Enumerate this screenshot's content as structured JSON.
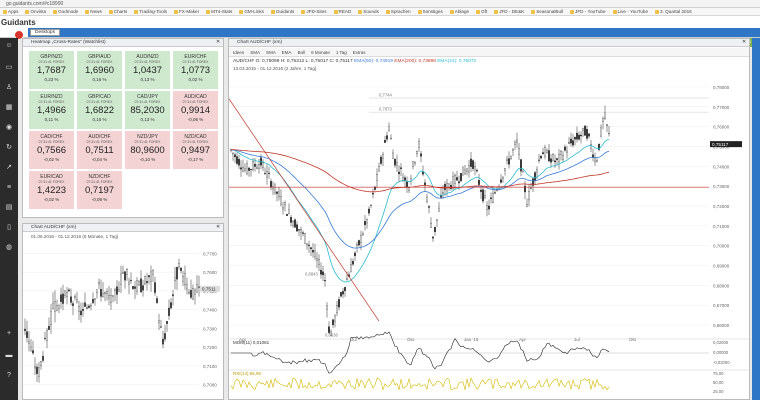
{
  "browser": {
    "url": "go.guidants.com/#c18990",
    "bookmarks": [
      "Apps",
      "Onvista",
      "Godmode",
      "News",
      "Charts",
      "Trading-Tools",
      "FX-Maker",
      "MT4-Stats",
      "GM-Links",
      "Guidants",
      "JFD-Sites",
      "READ",
      "Sounds",
      "Sprachen",
      "Sonstiges",
      "Ablage",
      "Gft",
      "JFD - DE&K",
      "SeasonalBull",
      "JFD - YouTube",
      "Live - YouTube",
      "3. Quartal 2016"
    ]
  },
  "app": {
    "logo": "Guidants",
    "desktops_label": "Desktops",
    "search_label": "Suche",
    "market_label": "Markt",
    "broker_label": "Broker Lo"
  },
  "heatmap": {
    "title": "Heatmap „Cross-Rates\" (Watchlist)",
    "tiles": [
      {
        "pair": "GBP/NZD",
        "sub": "07:31:41 FOREX",
        "value": "1,7687",
        "pct": "0,23 %",
        "tone": "green"
      },
      {
        "pair": "GBP/AUD",
        "sub": "07:31:41 FOREX",
        "value": "1,6960",
        "pct": "0,16 %",
        "tone": "green"
      },
      {
        "pair": "AUD/NZD",
        "sub": "07:31:41 FOREX",
        "value": "1,0437",
        "pct": "0,13 %",
        "tone": "green"
      },
      {
        "pair": "EUR/CHF",
        "sub": "07:31:41 FOREX",
        "value": "1,0773",
        "pct": "0,02 %",
        "tone": "green"
      },
      {
        "pair": "EUR/NZD",
        "sub": "07:31:41 FOREX",
        "value": "1,4966",
        "pct": "0,11 %",
        "tone": "green"
      },
      {
        "pair": "GBP/CAD",
        "sub": "07:31:41 FOREX",
        "value": "1,6822",
        "pct": "0,15 %",
        "tone": "green"
      },
      {
        "pair": "CAD/JPY",
        "sub": "07:31:41 FOREX",
        "value": "85,2030",
        "pct": "0,13 %",
        "tone": "green"
      },
      {
        "pair": "AUD/CAD",
        "sub": "07:31:41 FOREX",
        "value": "0,9914",
        "pct": "-0,06 %",
        "tone": "red"
      },
      {
        "pair": "CAD/CHF",
        "sub": "07:31:41 FOREX",
        "value": "0,7566",
        "pct": "-0,02 %",
        "tone": "red"
      },
      {
        "pair": "AUD/CHF",
        "sub": "07:31:41 FOREX",
        "value": "0,7511",
        "pct": "-0,04 %",
        "tone": "red"
      },
      {
        "pair": "NZD/JPY",
        "sub": "07:31:41 FOREX",
        "value": "80,9600",
        "pct": "-0,10 %",
        "tone": "red"
      },
      {
        "pair": "NZD/CAD",
        "sub": "07:31:41 FOREX",
        "value": "0,9497",
        "pct": "-0,17 %",
        "tone": "red"
      },
      {
        "pair": "EUR/CAD",
        "sub": "07:31:41 FOREX",
        "value": "1,4223",
        "pct": "-0,02 %",
        "tone": "red"
      },
      {
        "pair": "NZD/CHF",
        "sub": "07:31:41 FOREX",
        "value": "0,7197",
        "pct": "-0,09 %",
        "tone": "red"
      }
    ]
  },
  "small_chart": {
    "title": "Chart AUD/CHF (xm)",
    "range": "01.06.2016 - 01.12.2016",
    "timeframe": "(6 Monate, 1 Tag)",
    "current_price": "0,7511",
    "price_ticks": [
      "0,7700",
      "0,7600",
      "0,7500",
      "0,7400",
      "0,7300",
      "0,7200",
      "0,7100",
      "0,7000"
    ]
  },
  "big_chart": {
    "title": "Chart AUD/CHF (xm)",
    "toolbar": [
      "Ideen",
      "SMA",
      "SMA",
      "EMA",
      "Boll",
      "6 Monate",
      "1 Tag",
      "Extras"
    ],
    "ohlc": "AUD/CHF  O: 0,75099  H: 0,75312  L: 0,75017  C: 0,75117",
    "ema50": "EMA(50): 0,74919",
    "ema200": "EMA(200): 0,73898",
    "ema21": "EMA(21): 0,75072",
    "range": "13.03.2015 - 01.12.2016  (2 Jahre, 1 Tag)",
    "current_price": "0,75117",
    "level_high1": "0,7744",
    "level_high2": "0,7673",
    "level_low1": "0,6843",
    "level_low2": "0,6536",
    "price_ticks": [
      "0,78000",
      "0,77000",
      "0,76000",
      "0,75000",
      "0,74000",
      "0,73000",
      "0,72000",
      "0,71000",
      "0,70000",
      "0,69000",
      "0,68000",
      "0,67000",
      "0,66000"
    ],
    "time_ticks": [
      "Apr",
      "Jul",
      "Okt",
      "Jan '16",
      "Apr",
      "Jul",
      "Okt"
    ],
    "mom_label": "MOM(11)  0,01081",
    "mom_ticks": [
      "0,02000",
      "0,00000",
      "-0,02000"
    ],
    "rsi_label": "RSI(14)  56,96",
    "rsi_ticks": [
      "75,00",
      "50,00",
      "25,00"
    ]
  },
  "colors": {
    "candle": "#2b2b2b",
    "ema_blue": "#3a7bd5",
    "ema_red": "#c0392b",
    "ema_cyan": "#2bbbd0",
    "trend_red": "#c0392b",
    "hline_red": "#cc3333",
    "rsi": "#d4b800",
    "mom_pos": "#2e8b57",
    "mom_neg": "#d9534f"
  }
}
